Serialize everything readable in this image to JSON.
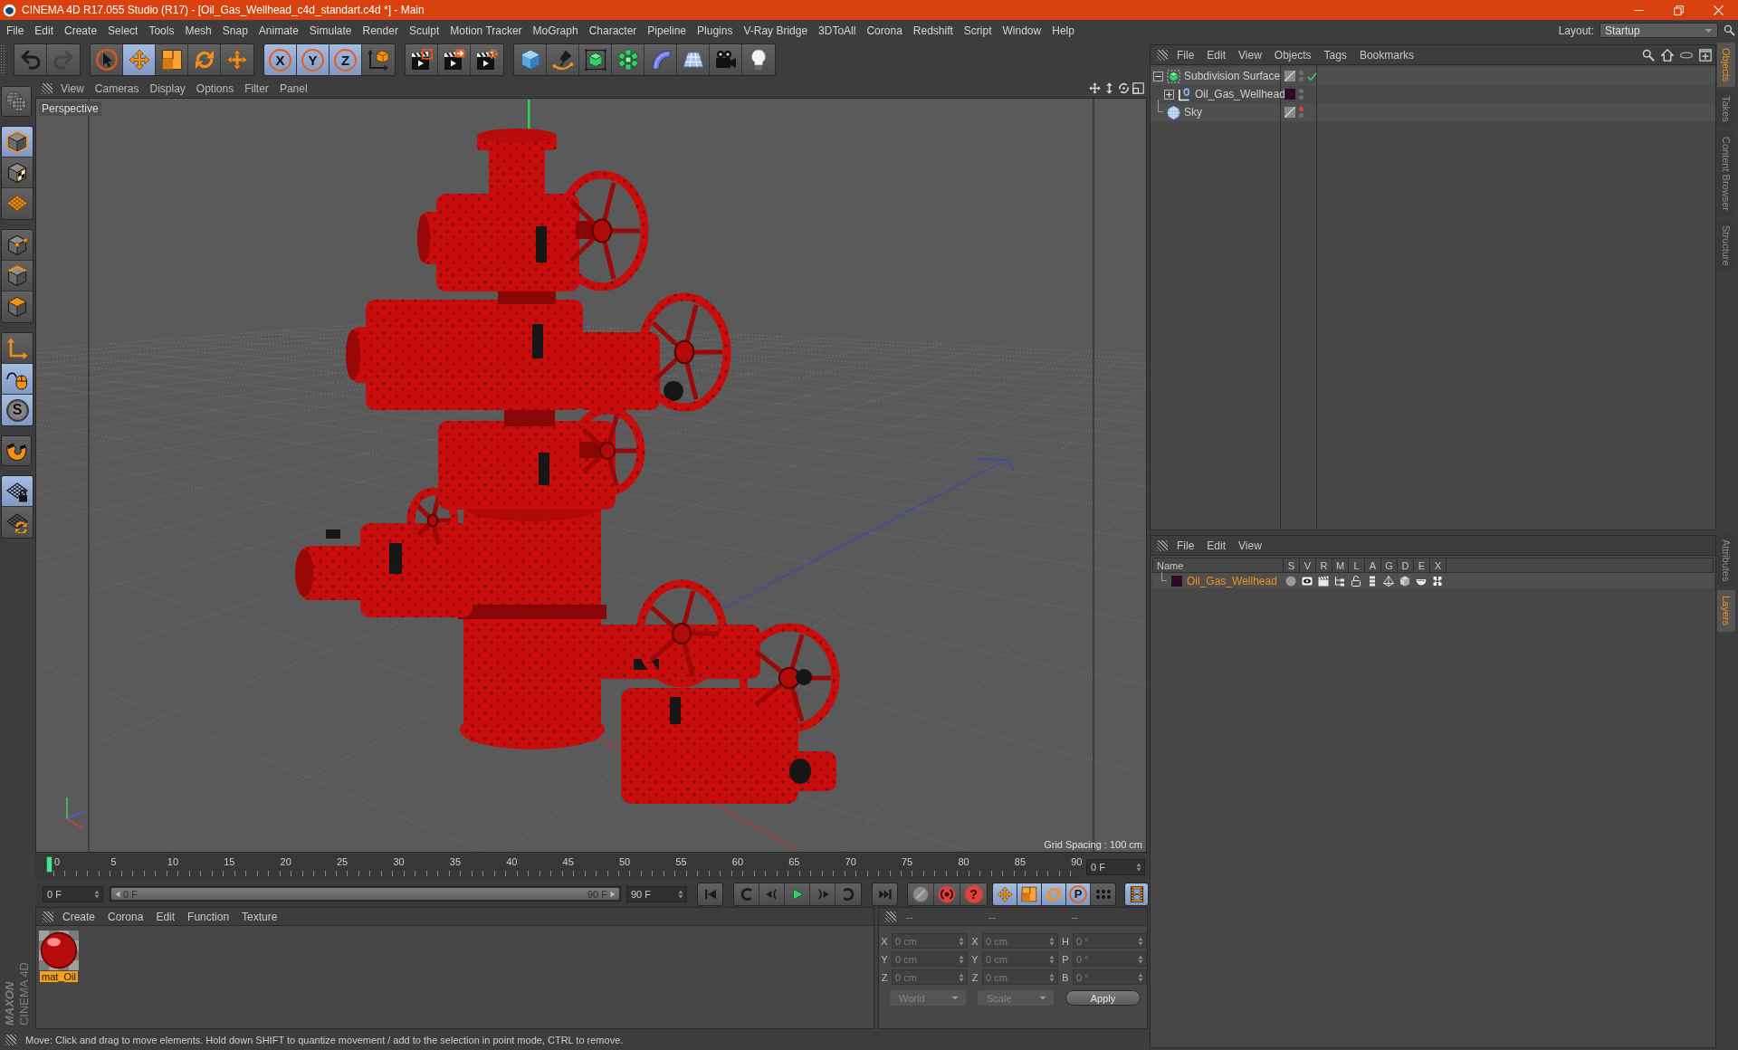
{
  "window": {
    "title": "CINEMA 4D R17.055 Studio (R17) - [Oil_Gas_Wellhead_c4d_standart.c4d *] - Main"
  },
  "menu_bar": [
    "File",
    "Edit",
    "Create",
    "Select",
    "Tools",
    "Mesh",
    "Snap",
    "Animate",
    "Simulate",
    "Render",
    "Sculpt",
    "Motion Tracker",
    "MoGraph",
    "Character",
    "Pipeline",
    "Plugins",
    "V-Ray Bridge",
    "3DToAll",
    "Corona",
    "Redshift",
    "Script",
    "Window",
    "Help"
  ],
  "layout": {
    "label": "Layout:",
    "value": "Startup"
  },
  "main_toolbar": [
    [
      {
        "selected": false,
        "disabled": false
      },
      {
        "selected": false,
        "disabled": true
      }
    ],
    [
      {
        "selected": false,
        "disabled": false
      },
      {
        "selected": true,
        "disabled": false
      },
      {
        "selected": false,
        "disabled": false
      },
      {
        "selected": false,
        "disabled": false
      },
      {
        "selected": false,
        "disabled": false
      }
    ],
    [
      {
        "label": "X",
        "selected": true,
        "disabled": false
      },
      {
        "label": "Y",
        "selected": true,
        "disabled": false
      },
      {
        "label": "Z",
        "selected": true,
        "disabled": false
      },
      {
        "selected": false,
        "disabled": false
      }
    ],
    [
      {
        "selected": false,
        "disabled": false
      },
      {
        "selected": false,
        "disabled": false
      },
      {
        "selected": false,
        "disabled": false
      }
    ],
    [
      {
        "selected": false,
        "disabled": false
      },
      {
        "selected": false,
        "disabled": false
      },
      {
        "selected": false,
        "disabled": false
      },
      {
        "selected": false,
        "disabled": false
      },
      {
        "selected": false,
        "disabled": false
      },
      {
        "selected": false,
        "disabled": false
      },
      {
        "selected": false,
        "disabled": false
      },
      {
        "selected": false,
        "disabled": false
      }
    ]
  ],
  "tool_palette": [
    [
      {
        "selected": false
      }
    ],
    [
      {
        "selected": true
      },
      {
        "selected": false
      },
      {
        "selected": false
      }
    ],
    [
      {
        "selected": false
      },
      {
        "selected": false
      },
      {
        "selected": false
      }
    ],
    [
      {
        "selected": false
      },
      {
        "selected": true
      },
      {
        "label": "S",
        "selected": true
      }
    ],
    [
      {
        "selected": false
      }
    ],
    [
      {
        "selected": true
      },
      {
        "selected": false
      }
    ]
  ],
  "logo": {
    "brand": "MAXON",
    "product": "CINEMA 4D"
  },
  "viewport": {
    "menu": [
      "View",
      "Cameras",
      "Display",
      "Options",
      "Filter",
      "Panel"
    ],
    "camera": "Perspective",
    "grid_info": "Grid Spacing : 100 cm"
  },
  "timeline": {
    "labels": [
      "0",
      "5",
      "10",
      "15",
      "20",
      "25",
      "30",
      "35",
      "40",
      "45",
      "50",
      "55",
      "60",
      "65",
      "70",
      "75",
      "80",
      "85",
      "90"
    ],
    "playhead": {
      "level": 0
    },
    "current_frame": "0 F"
  },
  "transport": {
    "start_field": "0 F",
    "range": {
      "start": "0 F",
      "end": "90 F",
      "level": 1
    },
    "end_field": "90 F",
    "key_buttons": [
      {
        "selected": false
      },
      {
        "selected": false
      },
      {
        "label": "?",
        "selected": false
      }
    ],
    "key_filters": [
      {
        "selected": true
      },
      {
        "selected": true
      },
      {
        "selected": true
      },
      {
        "label": "P",
        "selected": true
      },
      {
        "selected": false
      }
    ],
    "timeline_button": {
      "selected": true
    }
  },
  "material_manager": {
    "menu": [
      "Create",
      "Corona",
      "Edit",
      "Function",
      "Texture"
    ],
    "materials": [
      {
        "name": "mat_Oil",
        "selected": true
      }
    ]
  },
  "coordinates": {
    "headers": [
      "--",
      "--",
      "--"
    ],
    "disabled": true,
    "columns": [
      [
        {
          "axis": "X",
          "value": "0 cm"
        },
        {
          "axis": "Y",
          "value": "0 cm"
        },
        {
          "axis": "Z",
          "value": "0 cm"
        }
      ],
      [
        {
          "axis": "X",
          "value": "0 cm"
        },
        {
          "axis": "Y",
          "value": "0 cm"
        },
        {
          "axis": "Z",
          "value": "0 cm"
        }
      ],
      [
        {
          "axis": "H",
          "value": "0 °"
        },
        {
          "axis": "P",
          "value": "0 °"
        },
        {
          "axis": "B",
          "value": "0 °"
        }
      ]
    ],
    "dropdowns": [
      "World",
      "Scale"
    ],
    "apply": "Apply"
  },
  "status_bar": "Move: Click and drag to move elements. Hold down SHIFT to quantize movement / add to the selection in point mode, CTRL to remove.",
  "object_manager": {
    "menu": [
      "File",
      "Edit",
      "View",
      "Objects",
      "Tags",
      "Bookmarks"
    ],
    "objects": [
      {
        "kind": "subdivision",
        "name": "Subdivision Surface",
        "expanded": true,
        "editor_visible": true,
        "render_visible": true,
        "enabled": true,
        "children": [
          {
            "kind": "null",
            "name": "Oil_Gas_Wellhead",
            "expanded": false,
            "color": "#2d0a25",
            "editor_visible": true,
            "render_visible": true
          }
        ]
      },
      {
        "kind": "sky",
        "name": "Sky",
        "editor_visible": false,
        "render_visible": true
      }
    ]
  },
  "side_tabs_top": [
    {
      "label": "Objects",
      "selected": true
    },
    {
      "label": "Takes",
      "selected": false
    },
    {
      "label": "Content Browser",
      "selected": false
    },
    {
      "label": "Structure",
      "selected": false
    }
  ],
  "layer_manager": {
    "menu": [
      "File",
      "Edit",
      "View"
    ],
    "columns": [
      "Name",
      "S",
      "V",
      "R",
      "M",
      "L",
      "A",
      "G",
      "D",
      "E",
      "X"
    ],
    "layers": [
      {
        "name": "Oil_Gas_Wellhead",
        "color": "#2d0a25",
        "selected": true
      }
    ]
  },
  "side_tabs_bottom": [
    {
      "label": "Attributes",
      "selected": false
    },
    {
      "label": "Layers",
      "selected": true
    }
  ]
}
